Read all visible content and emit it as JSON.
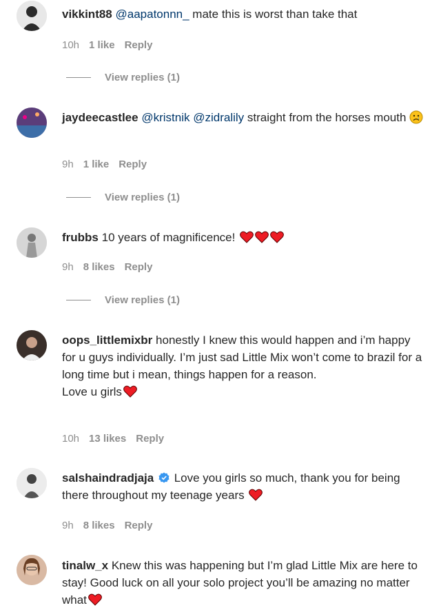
{
  "comments": [
    {
      "username": "vikkint88",
      "parts": [
        {
          "t": "mention",
          "v": "@aapatonnn_"
        },
        {
          "t": "text",
          "v": " mate this is worst than take that"
        }
      ],
      "time": "10h",
      "likes": "1 like",
      "reply": "Reply",
      "view_replies": "View replies (1)",
      "avatar_color": "#2b2b2b"
    },
    {
      "username": "jaydeecastlee",
      "parts": [
        {
          "t": "mention",
          "v": "@kristnik"
        },
        {
          "t": "text",
          "v": " "
        },
        {
          "t": "mention",
          "v": "@zidralily"
        },
        {
          "t": "text",
          "v": " straight from the horses mouth"
        }
      ],
      "emoji": "sad-face",
      "time": "9h",
      "likes": "1 like",
      "reply": "Reply",
      "view_replies": "View replies (1)",
      "avatar_color": "#5b3d7a"
    },
    {
      "username": "frubbs",
      "parts": [
        {
          "t": "text",
          "v": " 10 years of magnificence! "
        }
      ],
      "hearts": 3,
      "time": "9h",
      "likes": "8 likes",
      "reply": "Reply",
      "view_replies": "View replies (1)",
      "avatar_color": "#c9c9c9"
    },
    {
      "username": "oops_littlemixbr",
      "parts": [
        {
          "t": "text",
          "v": " honestly I knew this would happen and i’m happy for u guys individually. I’m just sad Little Mix won’t come to brazil for a long time but i mean, things happen for a reason.\nLove u girls"
        }
      ],
      "hearts": 1,
      "time": "10h",
      "likes": "13 likes",
      "reply": "Reply",
      "avatar_color": "#3a2f2a"
    },
    {
      "username": "salshaindradjaja",
      "verified": true,
      "parts": [
        {
          "t": "text",
          "v": " Love you girls so much, thank you for being there throughout my teenage years "
        }
      ],
      "hearts": 1,
      "time": "9h",
      "likes": "8 likes",
      "reply": "Reply",
      "avatar_color": "#e2e2e2"
    },
    {
      "username": "tinalw_x",
      "parts": [
        {
          "t": "text",
          "v": " Knew this was happening but I’m glad Little Mix are here to stay! Good luck on all your solo project you’ll be amazing no matter what"
        }
      ],
      "hearts": 1,
      "avatar_color": "#8a5a3c"
    }
  ],
  "colors": {
    "text": "#262626",
    "mention": "#00376b",
    "meta": "#8e8e8e",
    "heart": "#ed1c24",
    "verified": "#3897f0"
  }
}
